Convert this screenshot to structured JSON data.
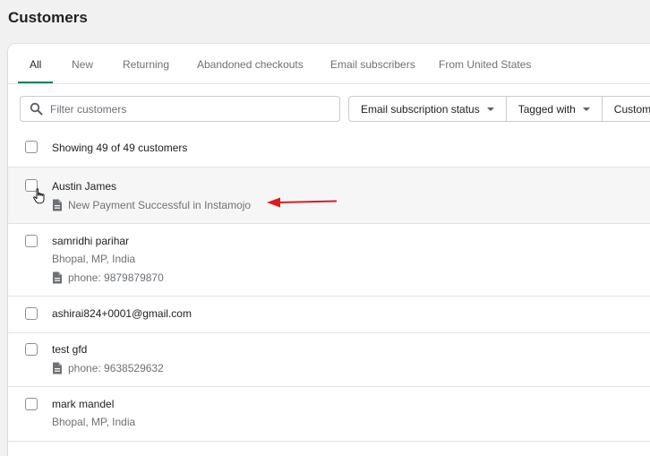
{
  "page": {
    "title": "Customers"
  },
  "tabs": [
    {
      "label": "All",
      "active": true
    },
    {
      "label": "New"
    },
    {
      "label": "Returning"
    },
    {
      "label": "Abandoned checkouts"
    },
    {
      "label": "Email subscribers"
    },
    {
      "label": "From United States"
    }
  ],
  "search": {
    "placeholder": "Filter customers",
    "value": ""
  },
  "filters": [
    {
      "label": "Email subscription status",
      "icon": "chevron-down-icon"
    },
    {
      "label": "Tagged with",
      "icon": "chevron-down-icon"
    },
    {
      "label": "Custome"
    }
  ],
  "list": {
    "summary": "Showing 49 of 49 customers",
    "rows": [
      {
        "name": "Austin James",
        "note": "New Payment Successful in Instamojo"
      },
      {
        "name": "samridhi parihar",
        "location": "Bhopal, MP, India",
        "note": "phone: 9879879870"
      },
      {
        "name": "ashirai824+0001@gmail.com"
      },
      {
        "name": "test gfd",
        "note": "phone: 9638529632"
      },
      {
        "name": "mark mandel",
        "location": "Bhopal, MP, India"
      }
    ]
  },
  "colors": {
    "accent": "#008060",
    "annotation_arrow": "#e01b1b"
  }
}
